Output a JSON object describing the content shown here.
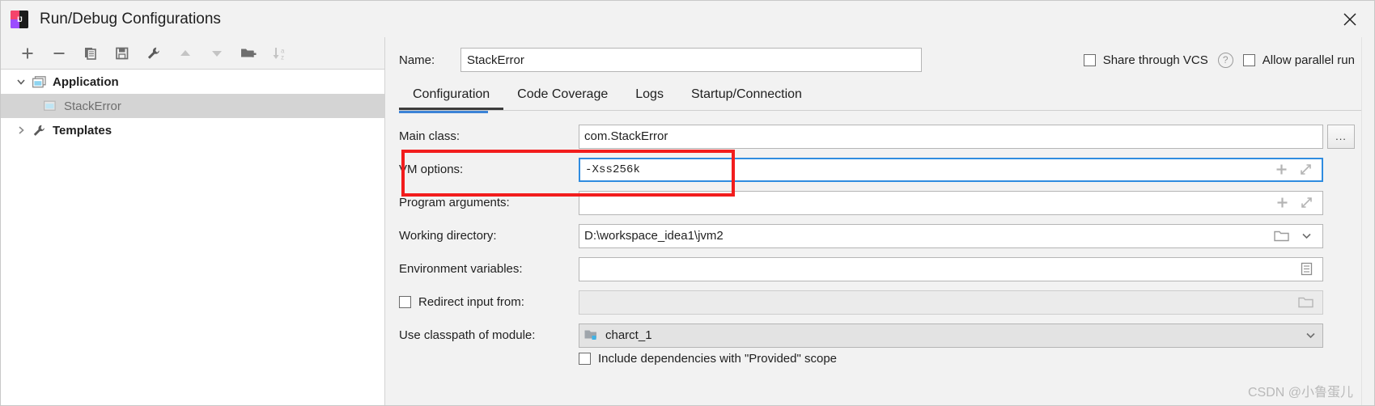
{
  "window": {
    "title": "Run/Debug Configurations",
    "logo_text": "IJ",
    "close_label": "×"
  },
  "toolbar": {
    "buttons": [
      {
        "name": "add-configuration-button",
        "icon": "plus-icon",
        "enabled": true
      },
      {
        "name": "remove-configuration-button",
        "icon": "minus-icon",
        "enabled": true
      },
      {
        "name": "copy-configuration-button",
        "icon": "copy-icon",
        "enabled": true
      },
      {
        "name": "save-configuration-button",
        "icon": "save-icon",
        "enabled": true
      },
      {
        "name": "edit-templates-button",
        "icon": "wrench-icon",
        "enabled": true
      },
      {
        "name": "move-up-button",
        "icon": "arrow-up-icon",
        "enabled": false
      },
      {
        "name": "move-down-button",
        "icon": "arrow-down-icon",
        "enabled": false
      },
      {
        "name": "new-folder-button",
        "icon": "folder-add-icon",
        "enabled": true
      },
      {
        "name": "sort-alphabetically-button",
        "icon": "sort-az-icon",
        "enabled": false
      }
    ]
  },
  "tree": {
    "nodes": [
      {
        "label": "Application",
        "icon": "application-icon",
        "twisty": "chevron-down-icon",
        "selected": false,
        "child": false
      },
      {
        "label": "StackError",
        "icon": "run-config-icon",
        "twisty": "",
        "selected": true,
        "child": true
      },
      {
        "label": "Templates",
        "icon": "wrench-icon",
        "twisty": "chevron-right-icon",
        "selected": false,
        "child": false
      }
    ]
  },
  "header": {
    "name_label": "Name:",
    "name_value": "StackError",
    "share_through_vcs": {
      "label": "Share through VCS",
      "checked": false
    },
    "help_icon_label": "?",
    "allow_parallel_run": {
      "label": "Allow parallel run",
      "checked": false
    }
  },
  "tabs": [
    {
      "label": "Configuration",
      "active": true
    },
    {
      "label": "Code Coverage",
      "active": false
    },
    {
      "label": "Logs",
      "active": false
    },
    {
      "label": "Startup/Connection",
      "active": false
    }
  ],
  "form": {
    "main_class": {
      "label": "Main class:",
      "value": "com.StackError",
      "browse_button_label": "..."
    },
    "vm_options": {
      "label": "VM options:",
      "value": "-Xss256k",
      "macro_icon": "plus-icon",
      "expand_icon": "expand-diagonal-icon",
      "highlighted": true
    },
    "program_arguments": {
      "label": "Program arguments:",
      "value": "",
      "macro_icon": "plus-icon",
      "expand_icon": "expand-diagonal-icon"
    },
    "working_directory": {
      "label": "Working directory:",
      "value": "D:\\workspace_idea1\\jvm2",
      "browse_icon": "folder-icon",
      "dropdown_icon": "chevron-down-icon"
    },
    "environment_variables": {
      "label": "Environment variables:",
      "value": "",
      "browse_icon": "list-icon"
    },
    "redirect_input_from": {
      "label": "Redirect input from:",
      "checked": false,
      "value": "",
      "browse_icon": "folder-icon"
    },
    "use_classpath_of_module": {
      "label": "Use classpath of module:",
      "value": "charct_1",
      "module_icon": "module-icon",
      "dropdown_icon": "chevron-down-icon"
    },
    "include_provided_scope": {
      "label": "Include dependencies with \"Provided\" scope",
      "checked": false
    }
  },
  "watermark": "CSDN @小鲁蛋儿",
  "colors": {
    "accent_blue": "#3c83d6",
    "focus_blue": "#2f8ce0",
    "highlight_red": "#f21d1d",
    "selection_gray": "#d4d4d4"
  }
}
